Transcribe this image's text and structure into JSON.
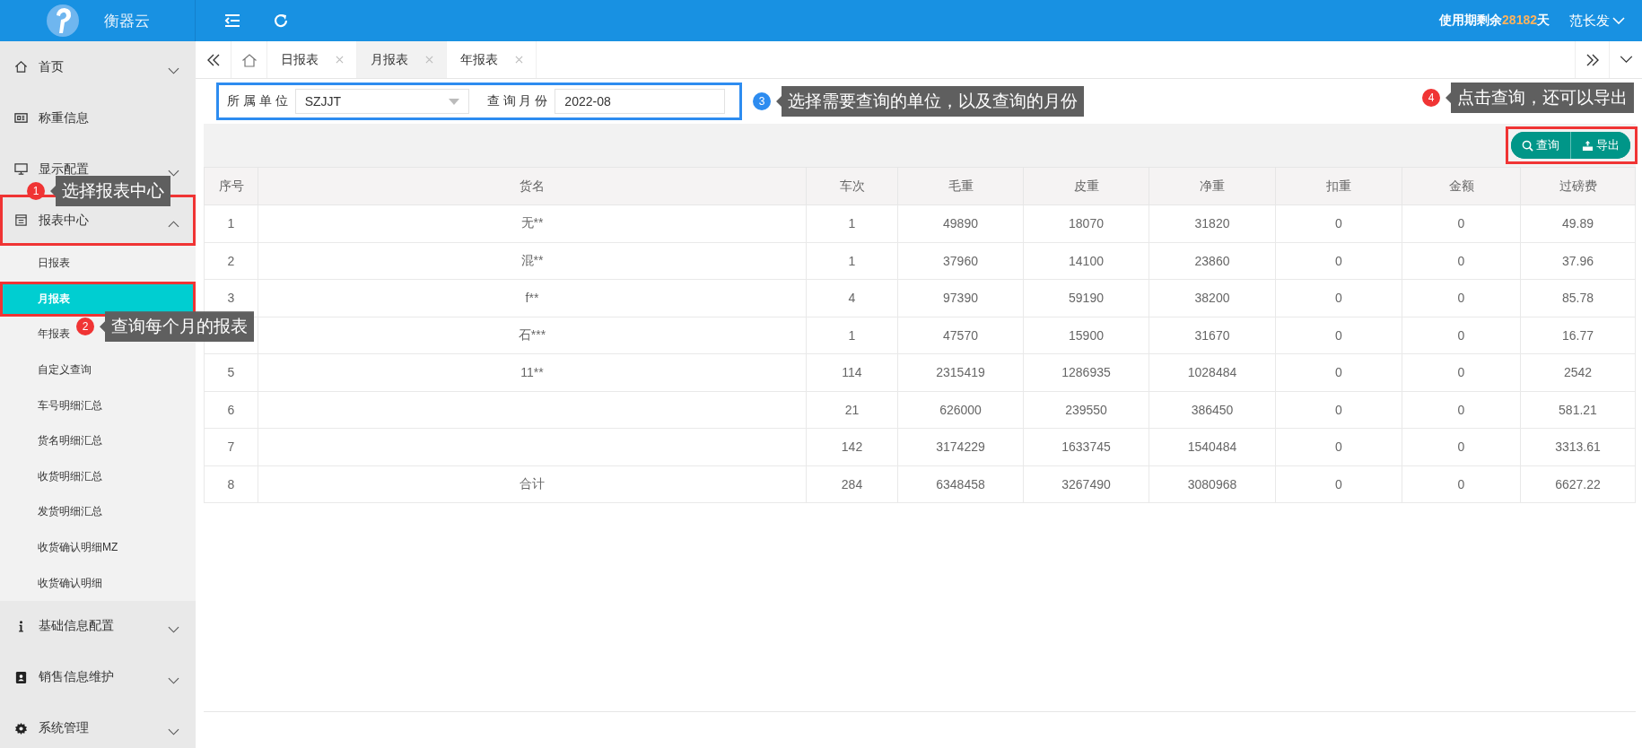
{
  "top_bar": {
    "app_name": "衡器云",
    "remaining_prefix": "使用期剩余",
    "remaining_days": "28182",
    "remaining_suffix": "天",
    "user": "范长发"
  },
  "sidebar": {
    "items": [
      {
        "label": "首页",
        "expanded": false,
        "highlighted": false
      },
      {
        "label": "称重信息",
        "highlighted": false
      },
      {
        "label": "显示配置",
        "expanded": false,
        "highlighted": false
      },
      {
        "label": "报表中心",
        "expanded": true,
        "highlighted": true,
        "annotation": {
          "number": "1",
          "text": "选择报表中心",
          "color": "#f03434"
        },
        "children": [
          {
            "label": "日报表",
            "selected": false,
            "highlighted": false
          },
          {
            "label": "月报表",
            "selected": true,
            "highlighted": true,
            "annotation": {
              "number": "2",
              "text": "查询每个月的报表",
              "color": "#f03434"
            }
          },
          {
            "label": "年报表",
            "selected": false,
            "highlighted": false
          },
          {
            "label": "自定义查询",
            "selected": false,
            "highlighted": false
          },
          {
            "label": "车号明细汇总",
            "selected": false,
            "highlighted": false
          },
          {
            "label": "货名明细汇总",
            "selected": false,
            "highlighted": false
          },
          {
            "label": "收货明细汇总",
            "selected": false,
            "highlighted": false
          },
          {
            "label": "发货明细汇总",
            "selected": false,
            "highlighted": false
          },
          {
            "label": "收货确认明细MZ",
            "selected": false,
            "highlighted": false
          },
          {
            "label": "收货确认明细",
            "selected": false,
            "highlighted": false
          }
        ]
      },
      {
        "label": "基础信息配置",
        "expanded": false,
        "highlighted": false
      },
      {
        "label": "销售信息维护",
        "expanded": false,
        "highlighted": false
      },
      {
        "label": "系统管理",
        "expanded": false,
        "highlighted": false
      }
    ]
  },
  "tabs": [
    {
      "label": "日报表",
      "selected": false
    },
    {
      "label": "月报表",
      "selected": true
    },
    {
      "label": "年报表",
      "selected": false
    }
  ],
  "filter": {
    "highlighted": true,
    "annotation": {
      "number": "3",
      "text": "选择需要查询的单位，以及查询的月份",
      "color": "#2d8cf0"
    },
    "unit_label": "所 属 单 位",
    "unit_value": "SZJJT",
    "month_label": "查 询 月 份",
    "month_value": "2022-08"
  },
  "toolbar": {
    "highlighted": true,
    "annotation": {
      "number": "4",
      "text": "点击查询，还可以导出",
      "color": "#f03434"
    },
    "buttons": [
      "查询",
      "导出"
    ]
  },
  "table": {
    "columns": [
      "序号",
      "货名",
      "车次",
      "毛重",
      "皮重",
      "净重",
      "扣重",
      "金额",
      "过磅费"
    ],
    "rows": [
      [
        "1",
        "无**",
        "1",
        "49890",
        "18070",
        "31820",
        "0",
        "0",
        "49.89"
      ],
      [
        "2",
        "混**",
        "1",
        "37960",
        "14100",
        "23860",
        "0",
        "0",
        "37.96"
      ],
      [
        "3",
        "f**",
        "4",
        "97390",
        "59190",
        "38200",
        "0",
        "0",
        "85.78"
      ],
      [
        null,
        "石***",
        "1",
        "47570",
        "15900",
        "31670",
        "0",
        "0",
        "16.77"
      ],
      [
        "5",
        "11**",
        "114",
        "2315419",
        "1286935",
        "1028484",
        "0",
        "0",
        "2542"
      ],
      [
        "6",
        null,
        "21",
        "626000",
        "239550",
        "386450",
        "0",
        "0",
        "581.21"
      ],
      [
        "7",
        null,
        "142",
        "3174229",
        "1633745",
        "1540484",
        "0",
        "0",
        "3313.61"
      ],
      [
        "8",
        "合计",
        "284",
        "6348458",
        "3267490",
        "3080968",
        "0",
        "0",
        "6627.22"
      ]
    ]
  }
}
